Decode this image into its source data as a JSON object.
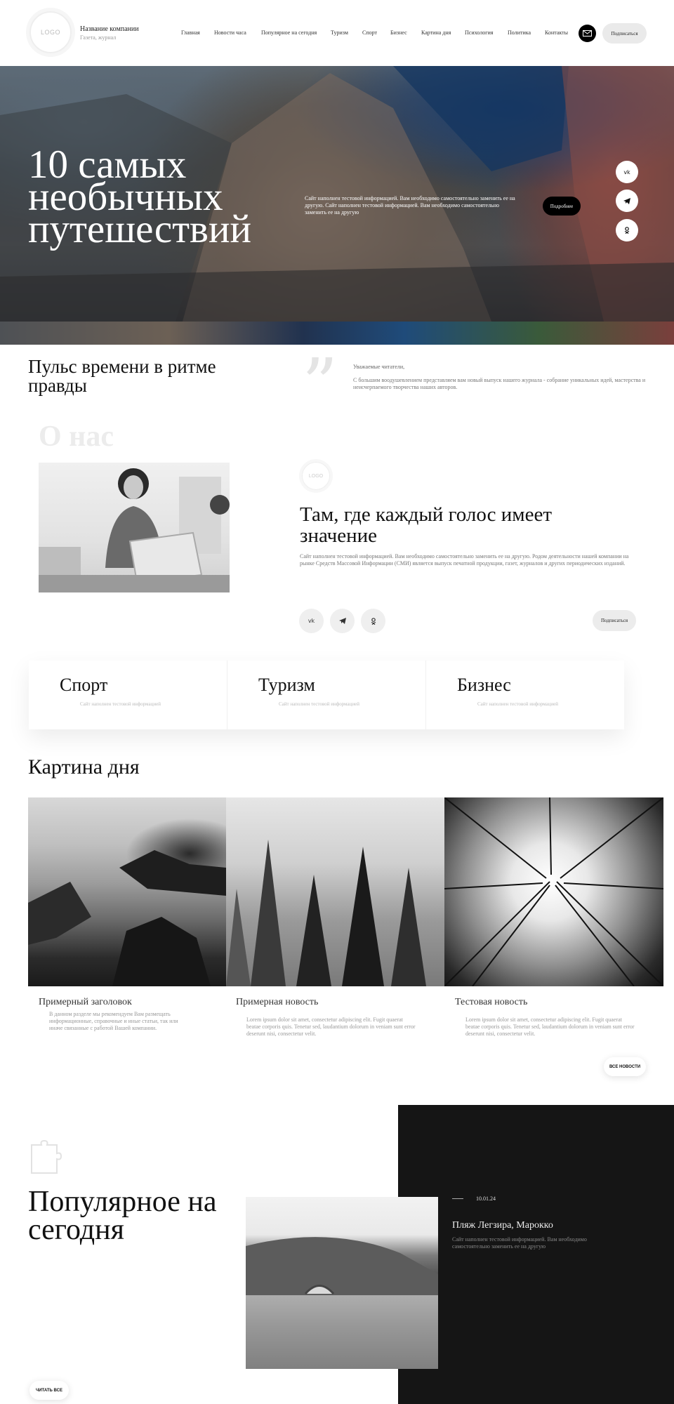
{
  "header": {
    "logo": "LOGO",
    "company_name": "Название компании",
    "company_sub": "Газета, журнал",
    "nav": [
      "Главная",
      "Новости часа",
      "Популярное на сегодня",
      "Туризм",
      "Спорт",
      "Бизнес",
      "Картина дня",
      "Психология",
      "Политика",
      "Контакты"
    ],
    "subscribe": "Подписаться"
  },
  "hero": {
    "title": "10 самых необычных путешествий",
    "text": "Сайт наполнен тестовой информацией. Вам необходимо самостоятельно заменить ее на другую. Сайт наполнен тестовой информацией. Вам необходимо самостоятельно заменить ее на другую",
    "more": "Подробнее",
    "social": [
      "vk",
      "tg",
      "ok"
    ]
  },
  "pulse": {
    "title": "Пульс времени в ритме правды",
    "greeting": "Уважаемые читатели,",
    "text": "С большим воодушевлением представляем вам новый выпуск нашего журнала - собрание уникальных идей, мастерства и неисчерпаемого творчества наших авторов."
  },
  "about": {
    "bg_title": "О нас",
    "logo": "LOGO",
    "title": "Там, где каждый голос имеет значение",
    "text": "Сайт наполнен тестовой информацией. Вам необходимо самостоятельно заменить ее на другую. Родом деятельности нашей компании на рынке Средств Массовой Информации (СМИ) является выпуск печатной продукции, газет, журналов и других периодических изданий.",
    "subscribe": "Подписаться",
    "social": [
      "vk",
      "tg",
      "ok"
    ]
  },
  "categories": [
    {
      "title": "Спорт",
      "sub": "Сайт наполнен тестовой информацией"
    },
    {
      "title": "Туризм",
      "sub": "Сайт наполнен тестовой информацией"
    },
    {
      "title": "Бизнес",
      "sub": "Сайт наполнен тестовой информацией"
    }
  ],
  "day": {
    "title": "Картина дня",
    "items": [
      {
        "title": "Примерный заголовок",
        "text": "В данном разделе мы рекомендуем Вам размещать информационные, справочные и иные статьи, так или иначе связанные с работой Вашей компании."
      },
      {
        "title": "Примерная новость",
        "text": "Lorem ipsum dolor sit amet, consectetur adipiscing elit. Fugit quaerat beatae corporis quis. Tenetur sed, laudantium dolorum in veniam sunt error deserunt nisi, consectetur velit."
      },
      {
        "title": "Тестовая новость",
        "text": "Lorem ipsum dolor sit amet, consectetur adipiscing elit. Fugit quaerat beatae corporis quis. Tenetur sed, laudantium dolorum in veniam sunt error deserunt nisi, consectetur velit."
      }
    ],
    "all_news": "ВСЕ НОВОСТИ"
  },
  "popular": {
    "title": "Популярное на сегодня",
    "date": "10.01.24",
    "headline": "Пляж Легзира, Марокко",
    "text": "Сайт наполнен тестовой информацией. Вам необходимо самостоятельно заменить ее на другую",
    "read_all": "ЧИТАТЬ ВСЕ"
  },
  "colors": {
    "accent": "#000000",
    "dark_panel": "#151515",
    "muted_text": "#999999"
  }
}
